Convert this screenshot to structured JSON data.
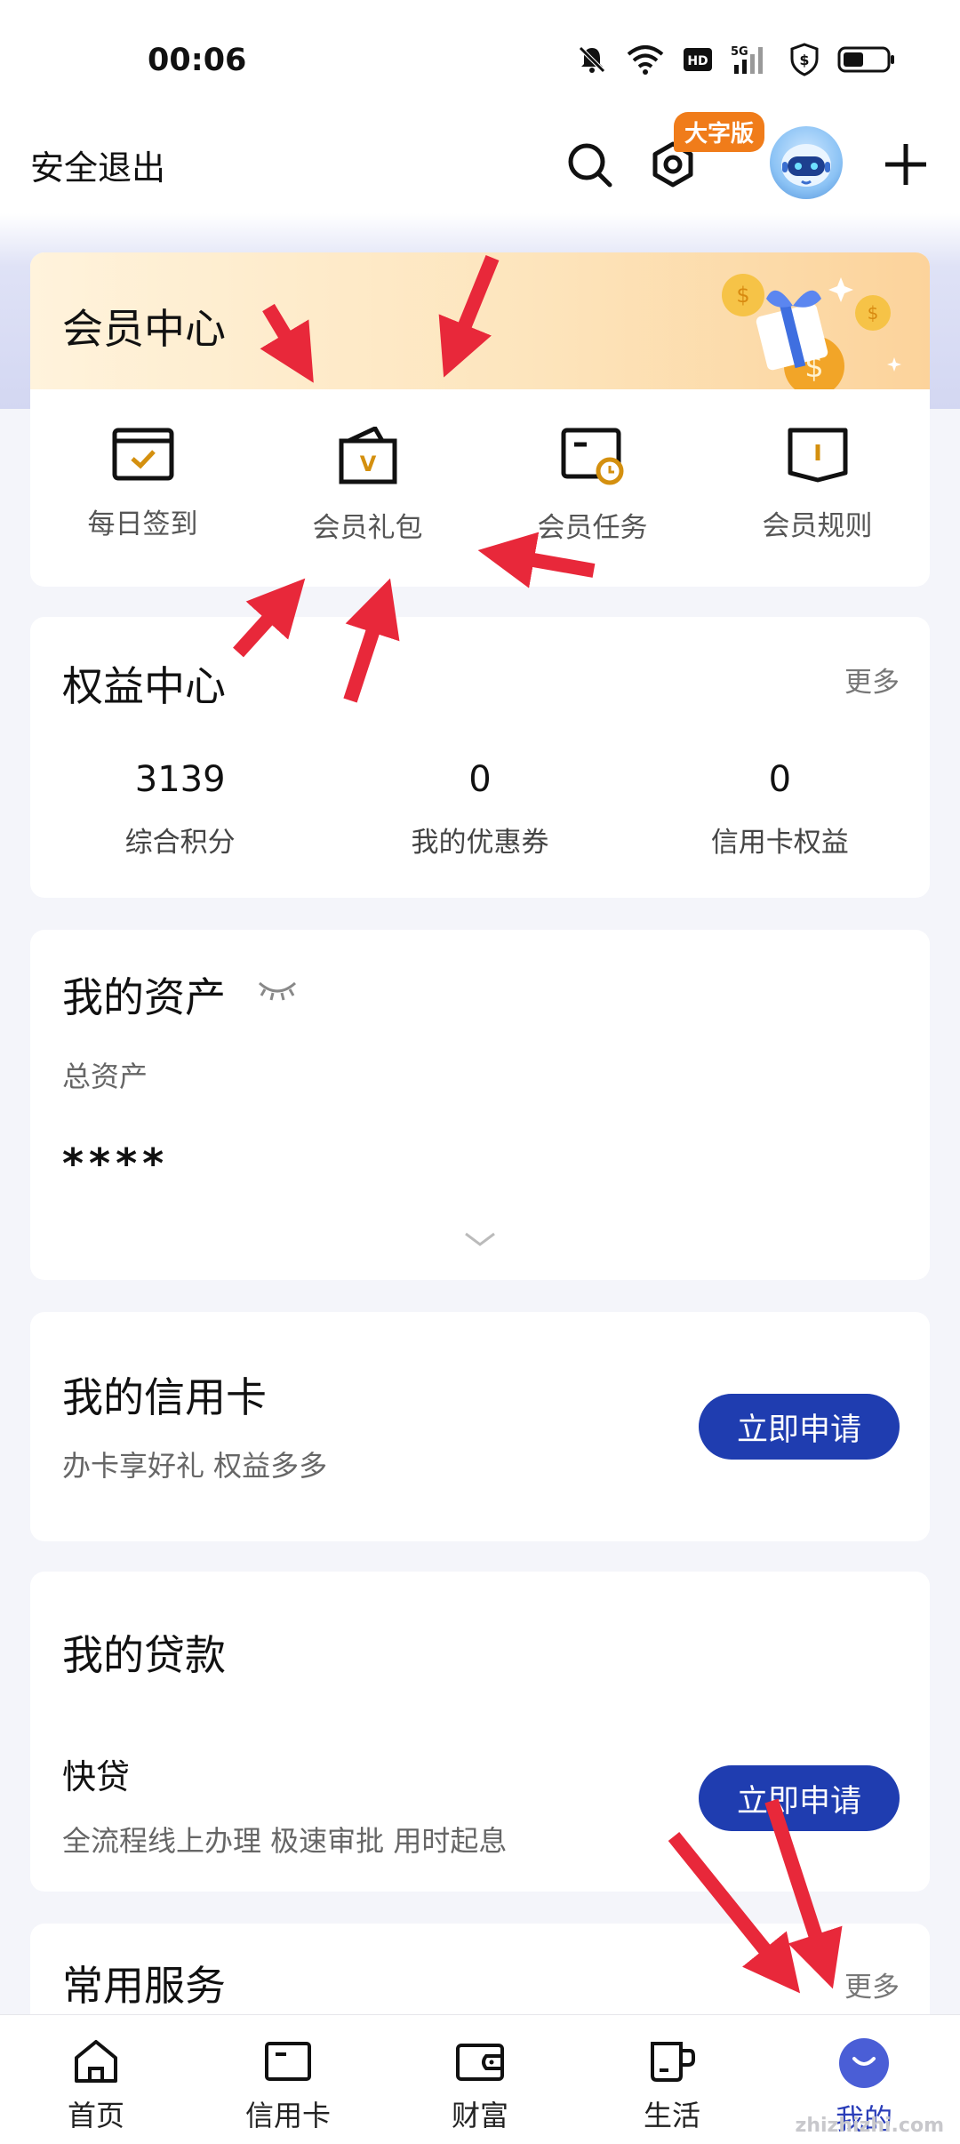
{
  "status_bar": {
    "time": "00:06",
    "network": "5G"
  },
  "header": {
    "logout_label": "安全退出",
    "large_font_badge": "大字版"
  },
  "member_center": {
    "title": "会员中心",
    "items": [
      {
        "label": "每日签到",
        "icon": "calendar-check-icon"
      },
      {
        "label": "会员礼包",
        "icon": "gift-bag-icon"
      },
      {
        "label": "会员任务",
        "icon": "task-clock-icon"
      },
      {
        "label": "会员规则",
        "icon": "rulebook-icon"
      }
    ]
  },
  "rights_center": {
    "title": "权益中心",
    "more": "更多",
    "stats": [
      {
        "value": "3139",
        "label": "综合积分"
      },
      {
        "value": "0",
        "label": "我的优惠券"
      },
      {
        "value": "0",
        "label": "信用卡权益"
      }
    ]
  },
  "assets": {
    "title": "我的资产",
    "total_label": "总资产",
    "total_value": "****"
  },
  "credit_card": {
    "title": "我的信用卡",
    "subtitle": "办卡享好礼 权益多多",
    "apply_label": "立即申请"
  },
  "loan": {
    "title": "我的贷款",
    "product_name": "快贷",
    "product_desc": "全流程线上办理 极速审批 用时起息",
    "apply_label": "立即申请"
  },
  "services": {
    "title": "常用服务",
    "more": "更多"
  },
  "tabbar": {
    "tabs": [
      {
        "label": "首页",
        "icon": "home-icon"
      },
      {
        "label": "信用卡",
        "icon": "credit-card-icon"
      },
      {
        "label": "财富",
        "icon": "wallet-icon"
      },
      {
        "label": "生活",
        "icon": "cup-icon"
      },
      {
        "label": "我的",
        "icon": "profile-smile-icon",
        "active": true
      }
    ]
  },
  "watermark": "zhizhizhi.com",
  "colors": {
    "accent": "#1f3db0",
    "badge": "#f07c1a",
    "arrow": "#e8283a",
    "icon_gold": "#d4900f"
  }
}
